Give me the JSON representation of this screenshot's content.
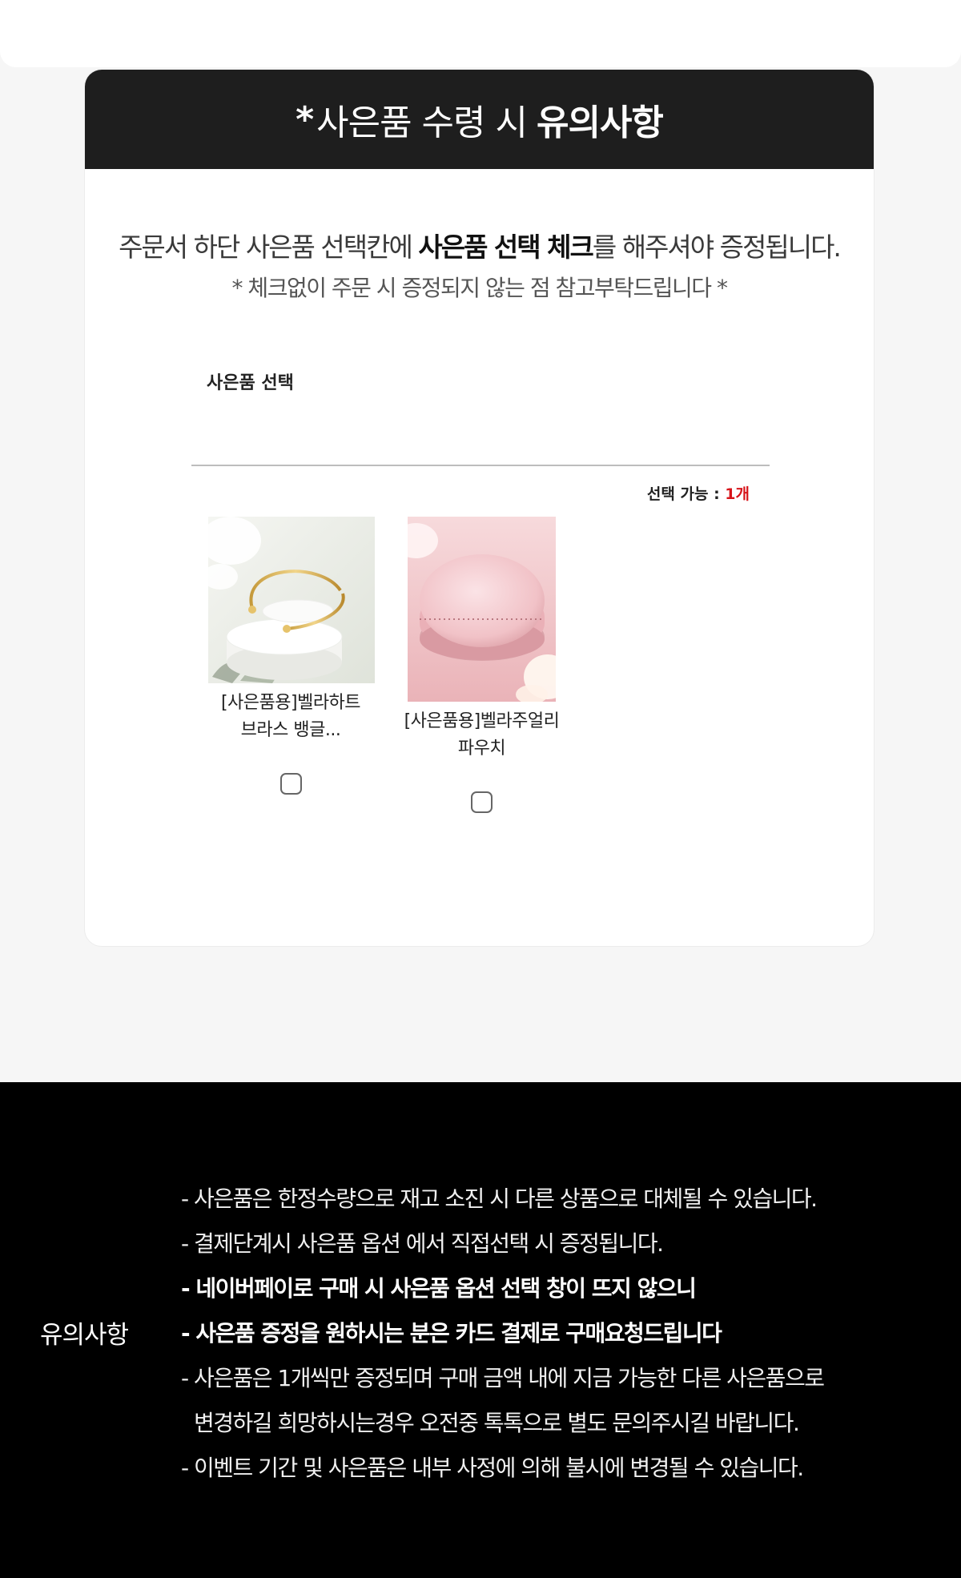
{
  "header": {
    "star": "*",
    "title_normal": "사은품 수령 시",
    "title_bold": "유의사항"
  },
  "notice": {
    "line1_pre": "주문서 하단 사은품 선택칸에 ",
    "line1_bold": "사은품 선택 체크",
    "line1_post": "를 해주셔야 증정됩니다.",
    "line2": "* 체크없이 주문 시 증정되지 않는 점 참고부탁드립니다 *"
  },
  "gift_select": {
    "title": "사은품 선택",
    "limit_label": "선택 가능 : ",
    "limit_count": "1개",
    "items": [
      {
        "name_line1": "[사은품용]벨라하트",
        "name_line2": "브라스 뱅글...",
        "image": "gold-bangle-on-white-stand",
        "checked": false
      },
      {
        "name_line1": "[사은품용]벨라주얼리",
        "name_line2": "파우치",
        "image": "pink-glitter-macaron-pouch",
        "checked": false
      }
    ]
  },
  "footer": {
    "label": "유의사항",
    "lines": [
      "- 사은품은 한정수량으로 재고 소진 시 다른 상품으로 대체될 수 있습니다.",
      "- 결제단계시 사은품 옵션 에서 직접선택 시 증정됩니다.",
      "- 네이버페이로 구매 시 사은품 옵션 선택 창이 뜨지 않으니",
      "- 사은품 증정을 원하시는 분은 카드 결제로 구매요청드립니다",
      "- 사은품은 1개씩만 증정되며  구매 금액 내에 지금 가능한  다른 사은품으로",
      "변경하길 희망하시는경우 오전중 톡톡으로 별도 문의주시길 바랍니다.",
      "- 이벤트 기간 및 사은품은 내부 사정에 의해 불시에 변경될 수 있습니다."
    ]
  },
  "colors": {
    "header_bg": "#1e1e1e",
    "accent_red": "#d7141a",
    "footer_bg": "#000000"
  }
}
